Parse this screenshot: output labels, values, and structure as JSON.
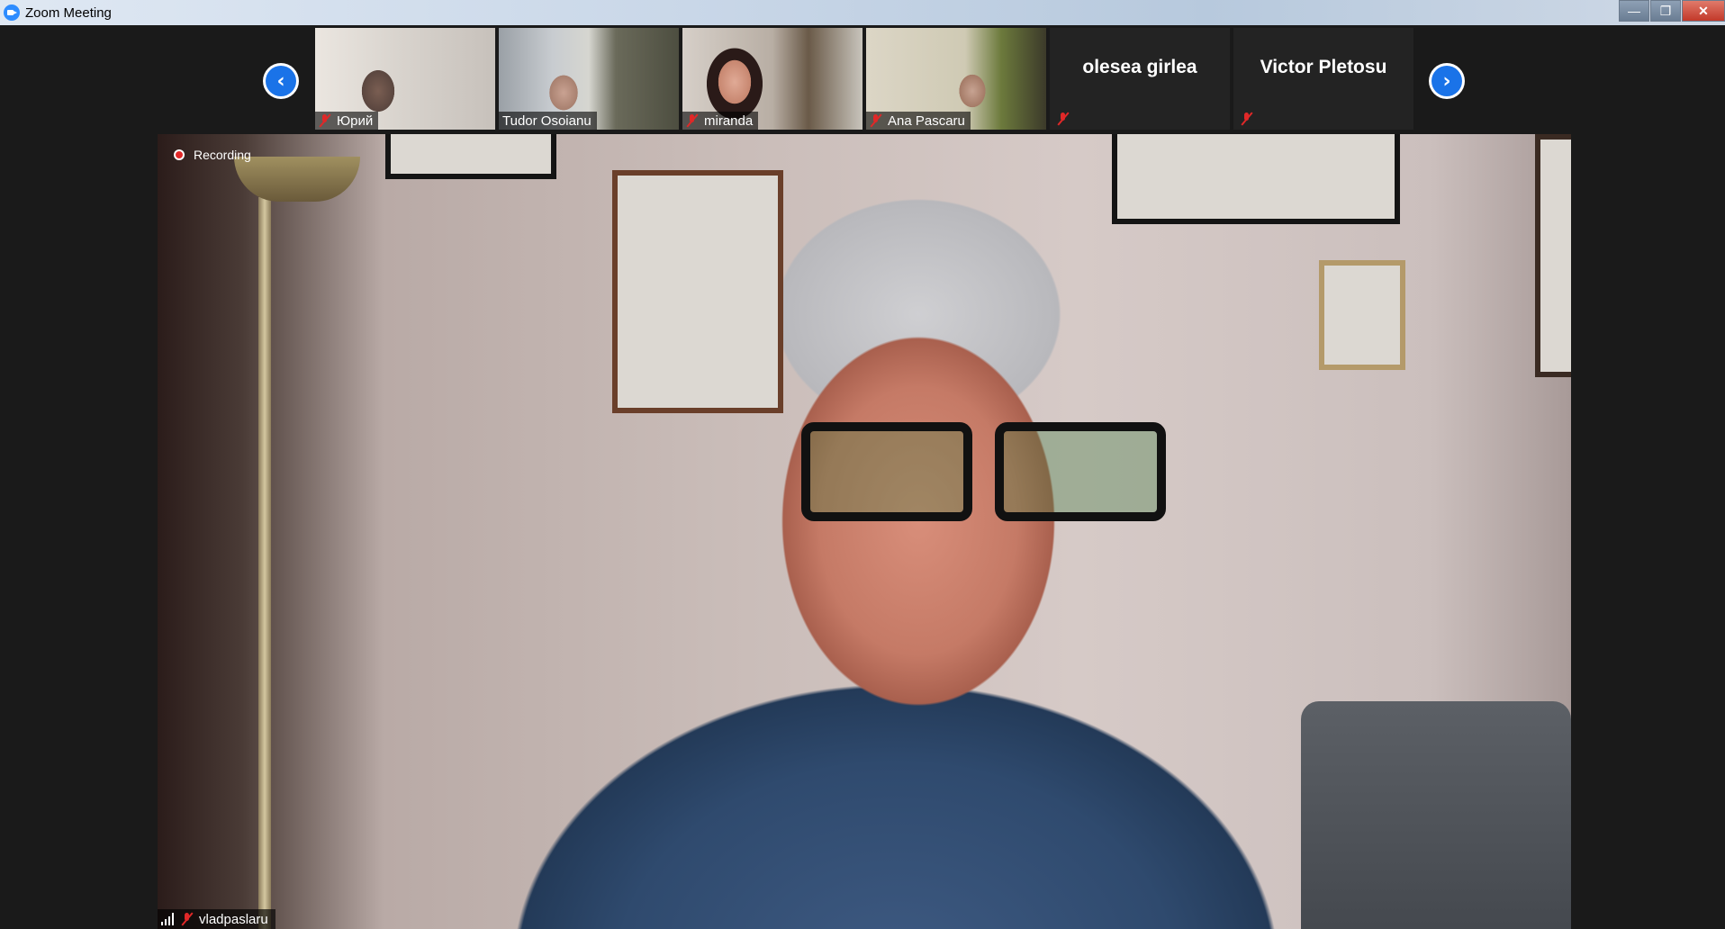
{
  "window": {
    "title": "Zoom Meeting",
    "controls": {
      "minimize": "—",
      "maximize": "❐",
      "close": "✕"
    }
  },
  "gallery": {
    "prev_icon": "‹",
    "next_icon": "›",
    "participants": [
      {
        "name": "Юрий",
        "muted": true,
        "video": true
      },
      {
        "name": "Tudor Osoianu",
        "muted": false,
        "video": true
      },
      {
        "name": "miranda",
        "muted": true,
        "video": true
      },
      {
        "name": "Ana Pascaru",
        "muted": true,
        "video": true
      },
      {
        "name": "olesea girlea",
        "muted": true,
        "video": false
      },
      {
        "name": "Victor Pletosu",
        "muted": true,
        "video": false
      }
    ]
  },
  "main": {
    "recording_label": "Recording",
    "speaker_name": "vladpaslaru",
    "speaker_muted": true
  },
  "colors": {
    "accent": "#1a73e8",
    "mute_red": "#e02828",
    "background": "#1a1a1a"
  }
}
